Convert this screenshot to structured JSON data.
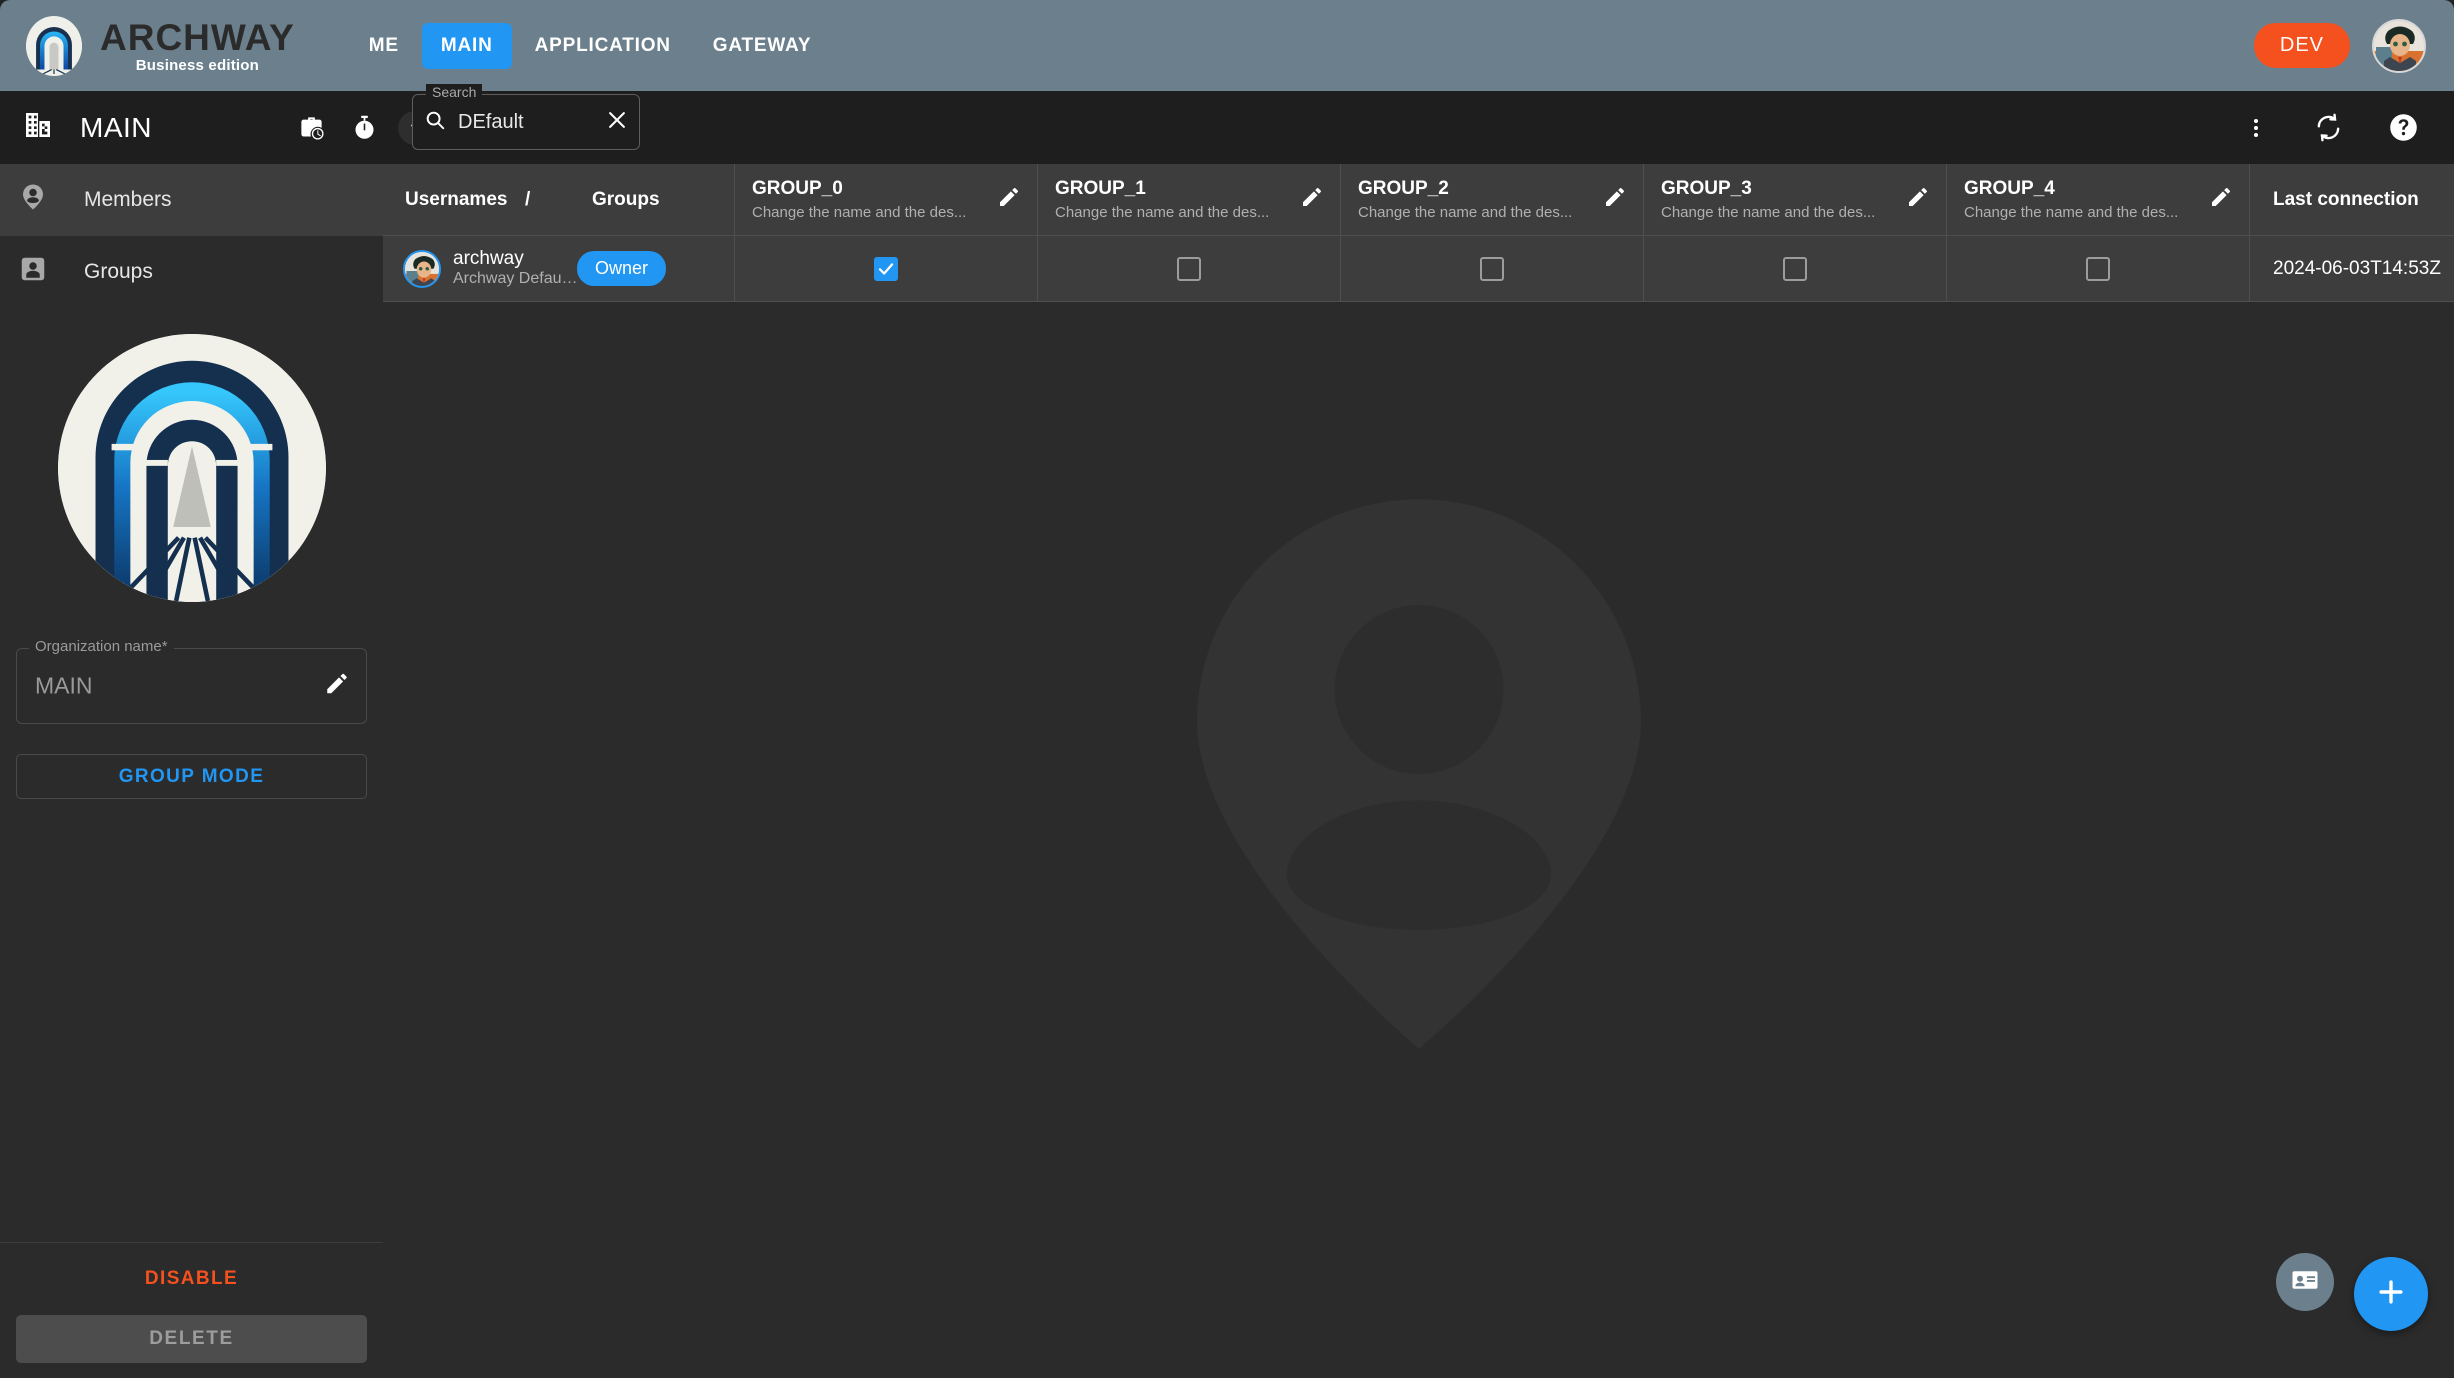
{
  "header": {
    "brand_name": "ARCHWAY",
    "brand_subtitle": "Business edition",
    "nav": [
      {
        "label": "ME",
        "active": false
      },
      {
        "label": "MAIN",
        "active": true
      },
      {
        "label": "APPLICATION",
        "active": false
      },
      {
        "label": "GATEWAY",
        "active": false
      }
    ],
    "env_badge": "DEV",
    "accent_color": "#2196f3",
    "badge_color": "#f4511e",
    "bar_color": "#6b808c"
  },
  "toolbar": {
    "title": "MAIN",
    "icons": [
      "business-icon",
      "work-history-icon",
      "timer-icon",
      "collapse-left-icon"
    ],
    "right_icons": [
      "more-vertical-icon",
      "sync-icon",
      "help-icon"
    ]
  },
  "search": {
    "legend": "Search",
    "value": "DEfault",
    "placeholder": "Search"
  },
  "sidebar": {
    "items": [
      {
        "label": "Members",
        "icon": "account-pin-icon",
        "selected": true
      },
      {
        "label": "Groups",
        "icon": "account-box-icon",
        "selected": false
      }
    ],
    "org_field": {
      "legend": "Organization name*",
      "value": "MAIN"
    },
    "group_mode_label": "GROUP MODE",
    "disable_label": "DISABLE",
    "delete_label": "DELETE"
  },
  "table": {
    "columns": {
      "usernames": "Usernames",
      "separator": "/",
      "groups": "Groups",
      "last_connection": "Last connection"
    },
    "groups": [
      {
        "name": "GROUP_0",
        "description": "Change the name and the des..."
      },
      {
        "name": "GROUP_1",
        "description": "Change the name and the des..."
      },
      {
        "name": "GROUP_2",
        "description": "Change the name and the des..."
      },
      {
        "name": "GROUP_3",
        "description": "Change the name and the des..."
      },
      {
        "name": "GROUP_4",
        "description": "Change the name and the des..."
      }
    ],
    "rows": [
      {
        "username": "archway",
        "subtitle": "Archway Default Sys...",
        "role": "Owner",
        "memberships": [
          true,
          false,
          false,
          false,
          false
        ],
        "last_connection": "2024-06-03T14:53Z"
      }
    ]
  },
  "fabs": {
    "badge_icon": "contact-card-icon",
    "add_icon": "plus-icon"
  }
}
